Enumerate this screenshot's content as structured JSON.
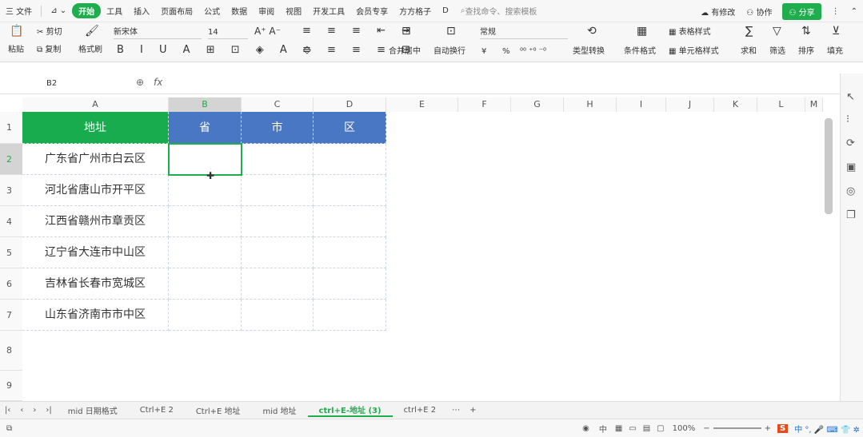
{
  "menu": {
    "file": "三 文件",
    "tabs": [
      "开始",
      "工具",
      "插入",
      "页面布局",
      "公式",
      "数据",
      "审阅",
      "视图",
      "开发工具",
      "会员专享",
      "方方格子",
      "D"
    ],
    "active_tab": "开始",
    "search": "查找命令、搜索模板",
    "has_changes": "有修改",
    "collab": "协作",
    "share": "分享"
  },
  "ribbon": {
    "paste": "粘贴",
    "cut": "剪切",
    "copy": "复制",
    "format_painter": "格式刷",
    "font_name": "新宋体",
    "font_size": "14",
    "merge": "合并居中",
    "wrap": "自动换行",
    "number_format": "常规",
    "convert": "类型转换",
    "cond_format": "条件格式",
    "table_style": "表格样式",
    "cell_style": "单元格样式",
    "sum": "求和",
    "filter": "筛选",
    "sort": "排序",
    "fill": "填充",
    "currency": "¥",
    "percent": "%"
  },
  "formula": {
    "name_box": "B2",
    "fx": "fx"
  },
  "columns": [
    "A",
    "B",
    "C",
    "D",
    "E",
    "F",
    "G",
    "H",
    "I",
    "J",
    "K",
    "L",
    "M"
  ],
  "rows": [
    "1",
    "2",
    "3",
    "4",
    "5",
    "6",
    "7",
    "8",
    "9"
  ],
  "table": {
    "headers": [
      "地址",
      "省",
      "市",
      "区"
    ],
    "addresses": [
      "广东省广州市白云区",
      "河北省唐山市开平区",
      "江西省赣州市章贡区",
      "辽宁省大连市中山区",
      "吉林省长春市宽城区",
      "山东省济南市市中区"
    ]
  },
  "sheets": [
    "mid 日期格式",
    "Ctrl+E 2",
    "Ctrl+E 地址",
    "mid 地址",
    "ctrl+E-地址 (3)",
    "ctrl+E 2"
  ],
  "active_sheet": "ctrl+E-地址 (3)",
  "status": {
    "zoom": "100%",
    "ime": "中"
  },
  "colors": {
    "accent": "#1fad4e",
    "blue_header": "#4a77c4"
  }
}
